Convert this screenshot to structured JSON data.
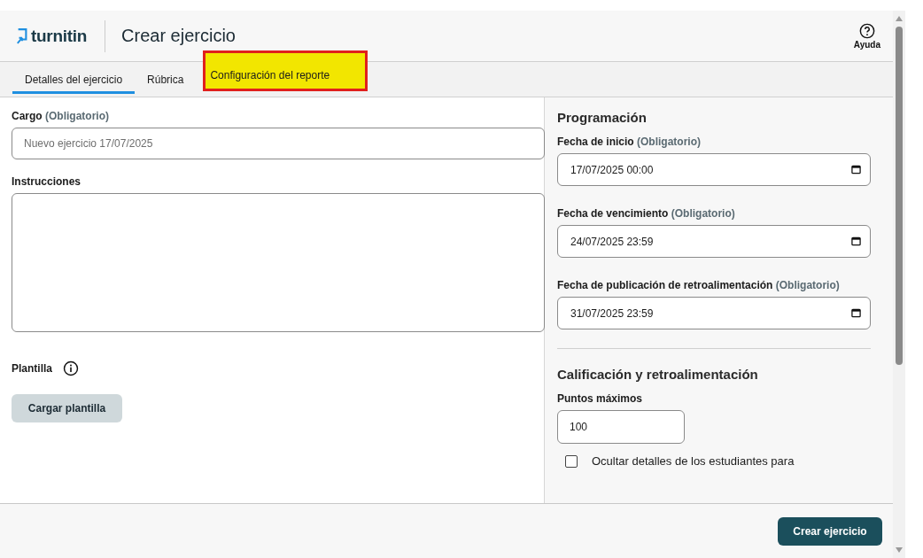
{
  "header": {
    "logo_text": "turnitin",
    "title": "Crear ejercicio",
    "help_label": "Ayuda"
  },
  "tabs": [
    {
      "label": "Detalles del ejercicio",
      "selected": true,
      "highlighted": false
    },
    {
      "label": "Rúbrica",
      "selected": false,
      "highlighted": false
    },
    {
      "label": "Configuración del reporte",
      "selected": false,
      "highlighted": true
    }
  ],
  "details": {
    "title_label": "Cargo",
    "title_required": "(Obligatorio)",
    "title_placeholder": "Nuevo ejercicio 17/07/2025",
    "instructions_label": "Instrucciones",
    "template_label": "Plantilla",
    "upload_button": "Cargar plantilla"
  },
  "schedule": {
    "heading": "Programación",
    "dates": [
      {
        "label": "Fecha de inicio",
        "required": "(Obligatorio)",
        "value": "17/07/2025 00:00"
      },
      {
        "label": "Fecha de vencimiento",
        "required": "(Obligatorio)",
        "value": "24/07/2025 23:59"
      },
      {
        "label": "Fecha de publicación de retroalimentación",
        "required": "(Obligatorio)",
        "value": "31/07/2025 23:59"
      }
    ]
  },
  "grading": {
    "heading": "Calificación y retroalimentación",
    "max_points_label": "Puntos máximos",
    "max_points_value": "100",
    "options": [
      {
        "label": "Ocultar detalles de los estudiantes para",
        "checked": false
      }
    ]
  },
  "footer": {
    "create_button": "Crear ejercicio"
  }
}
